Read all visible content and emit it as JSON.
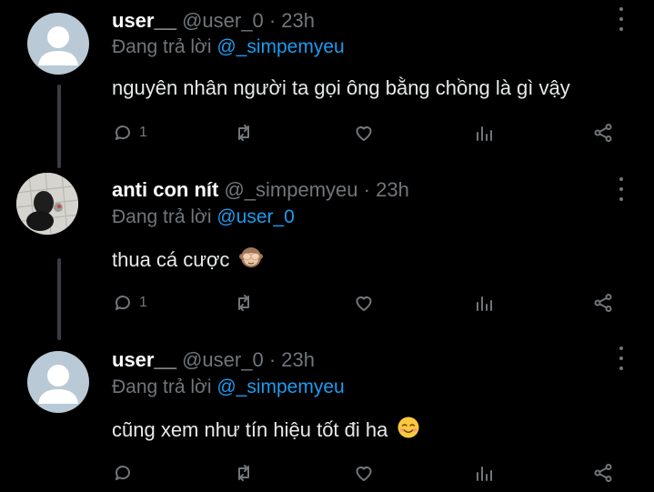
{
  "tweets": [
    {
      "name": "user__",
      "handle": "@user_0",
      "separator": "·",
      "time": "23h",
      "reply_prefix": "Đang trả lời",
      "reply_to": "@_simpemyeu",
      "text": "nguyên nhân người ta gọi ông bằng chồng là gì vậy",
      "reply_count": "1",
      "avatar": "default-avatar"
    },
    {
      "name": "anti con nít",
      "handle": "@_simpemyeu",
      "separator": "·",
      "time": "23h",
      "reply_prefix": "Đang trả lời",
      "reply_to": "@user_0",
      "text": "thua cá cược",
      "emoji": "see-no-evil-monkey-emoji",
      "reply_count": "1",
      "avatar": "photo-avatar"
    },
    {
      "name": "user__",
      "handle": "@user_0",
      "separator": "·",
      "time": "23h",
      "reply_prefix": "Đang trả lời",
      "reply_to": "@_simpemyeu",
      "text": "cũng xem như tín hiệu tốt đi ha",
      "emoji": "smiling-face-emoji",
      "reply_count": "",
      "avatar": "default-avatar"
    }
  ],
  "colors": {
    "background": "#000000",
    "text": "#e7e9ea",
    "secondary": "#71767b",
    "link": "#1d9bf0",
    "default_avatar": "#b9cad6"
  },
  "icons": [
    "reply-icon",
    "retweet-icon",
    "like-icon",
    "views-icon",
    "share-icon",
    "more-icon"
  ]
}
